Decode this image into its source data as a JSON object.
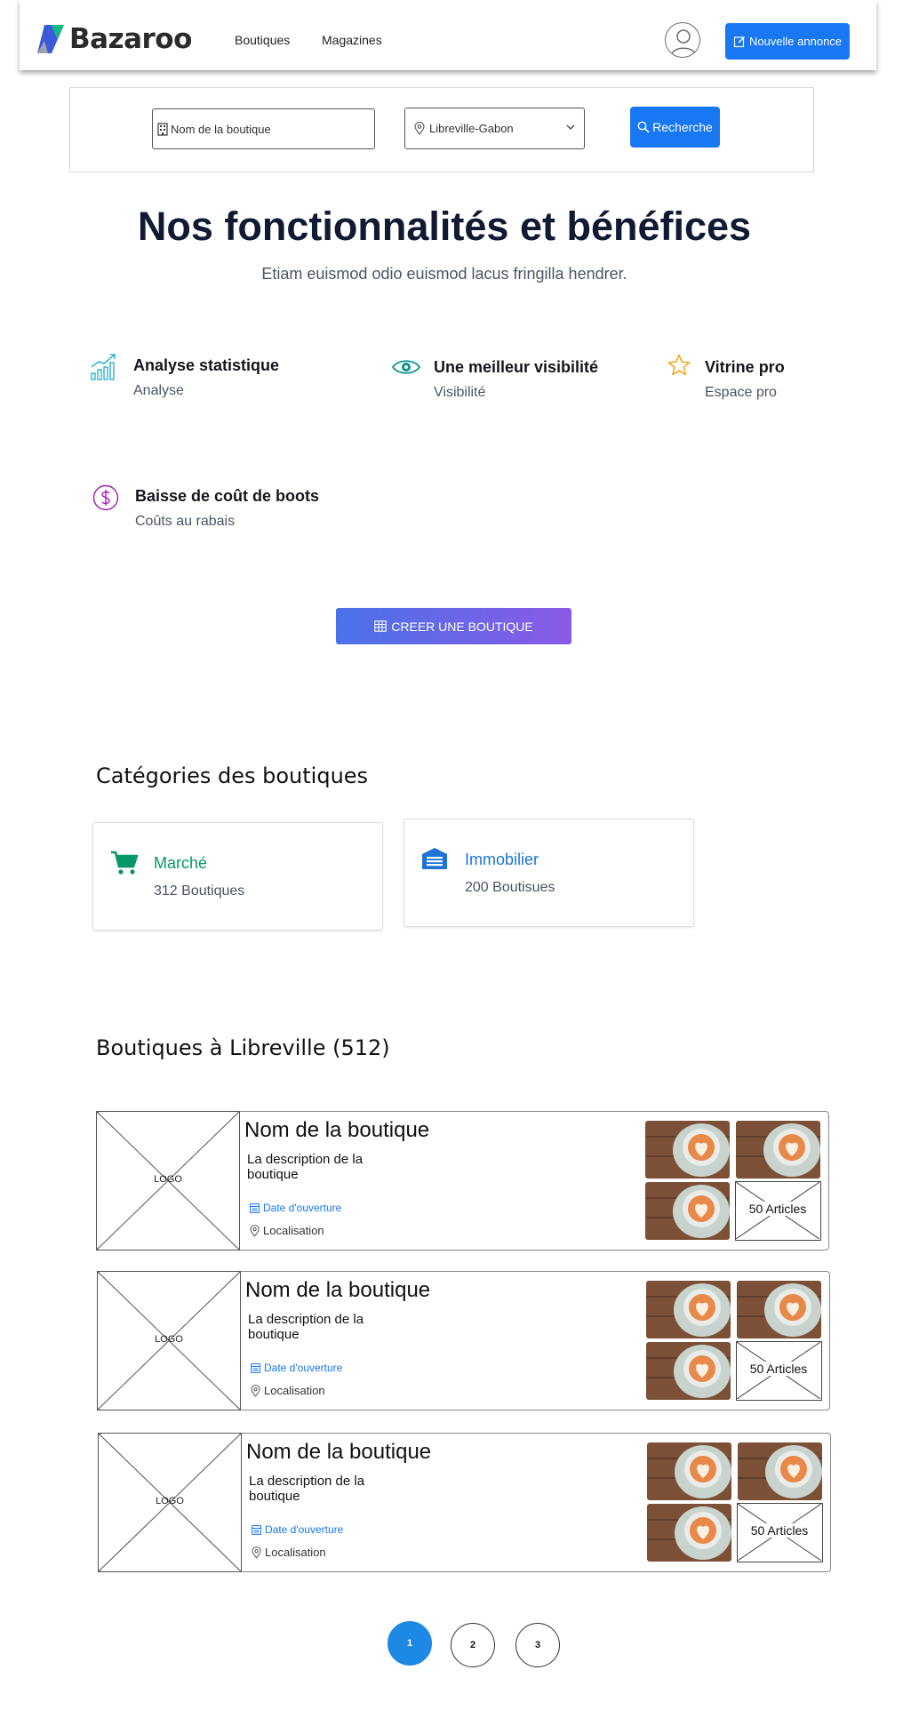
{
  "header": {
    "brand": "Bazaroo",
    "nav": [
      "Boutiques",
      "Magazines"
    ],
    "new_listing_label": "Nouvelle annonce"
  },
  "search": {
    "shop_placeholder": "Nom de la boutique",
    "city_value": "Libreville-Gabon",
    "button_label": "Recherche"
  },
  "features": {
    "title": "Nos fonctionnalités et bénéfices",
    "subtitle": "Etiam euismod odio euismod lacus fringilla hendrer.",
    "items": [
      {
        "title": "Analyse statistique",
        "desc": "Analyse",
        "icon": "chart-icon",
        "color": "#0ea5c9"
      },
      {
        "title": "Une meilleur visibilité",
        "desc": "Visibilité",
        "icon": "eye-icon",
        "color": "#0d9488"
      },
      {
        "title": "Vitrine pro",
        "desc": "Espace pro",
        "icon": "star-icon",
        "color": "#f59e0b"
      },
      {
        "title": "Baisse de coût de boots",
        "desc": "Coûts au rabais",
        "icon": "dollar-icon",
        "color": "#a21caf"
      }
    ],
    "cta_label": "CREER UNE BOUTIQUE"
  },
  "categories": {
    "title": "Catégories des boutiques",
    "items": [
      {
        "name": "Marché",
        "count": "312 Boutiques",
        "icon": "cart-icon",
        "color": "#059669"
      },
      {
        "name": "Immobilier",
        "count": "200 Boutisues",
        "icon": "building-icon",
        "color": "#1d74d4"
      }
    ]
  },
  "shops": {
    "title": "Boutiques à Libreville (512)",
    "items": [
      {
        "logo": "LOGO",
        "name": "Nom de la boutique",
        "description": "La description de la boutique",
        "date": "Date d'ouverture",
        "location": "Localisation",
        "articles": "50 Articles"
      },
      {
        "logo": "LOGO",
        "name": "Nom de la boutique",
        "description": "La description de la boutique",
        "date": "Date d'ouverture",
        "location": "Localisation",
        "articles": "50 Articles"
      },
      {
        "logo": "LOGO",
        "name": "Nom de la boutique",
        "description": "La description de la boutique",
        "date": "Date d'ouverture",
        "location": "Localisation",
        "articles": "50 Articles"
      }
    ]
  },
  "pagination": {
    "pages": [
      "1",
      "2",
      "3"
    ],
    "current": "1"
  },
  "colors": {
    "primary": "#1877f2",
    "title": "#111a33",
    "gradient_start": "#4a72e8",
    "gradient_end": "#8a5ae6"
  }
}
